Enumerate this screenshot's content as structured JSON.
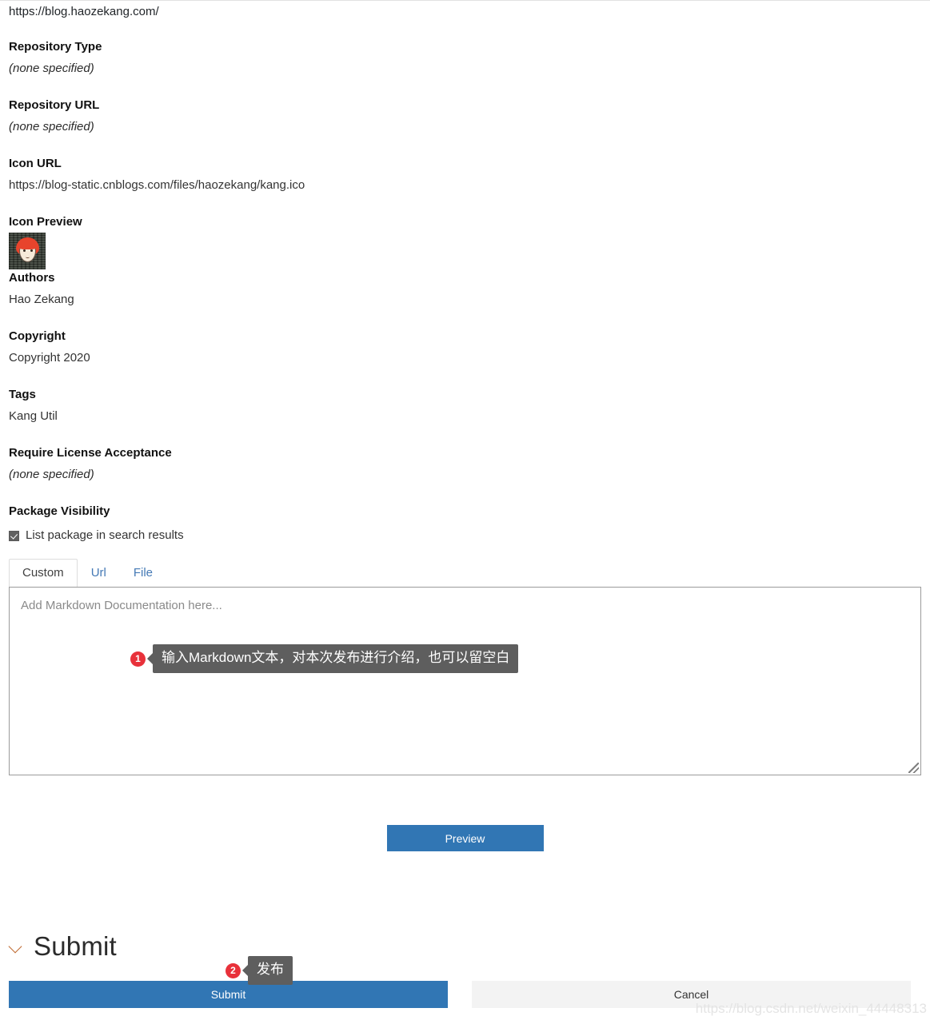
{
  "site_url": "https://blog.haozekang.com/",
  "metadata_fields": [
    {
      "label": "Repository Type",
      "value": "(none specified)",
      "italic": true
    },
    {
      "label": "Repository URL",
      "value": "(none specified)",
      "italic": true
    },
    {
      "label": "Icon URL",
      "value": "https://blog-static.cnblogs.com/files/haozekang/kang.ico",
      "italic": false
    }
  ],
  "icon_preview": {
    "label": "Icon Preview",
    "icon_name": "avatar-icon"
  },
  "authors": {
    "label": "Authors",
    "value": "Hao Zekang"
  },
  "copyright": {
    "label": "Copyright",
    "value": "Copyright 2020"
  },
  "tags": {
    "label": "Tags",
    "value": "Kang Util"
  },
  "require_license": {
    "label": "Require License Acceptance",
    "value": "(none specified)"
  },
  "package_visibility": {
    "label": "Package Visibility",
    "checkbox_label": "List package in search results",
    "checked": true
  },
  "doc_tabs": [
    {
      "label": "Custom",
      "active": true
    },
    {
      "label": "Url",
      "active": false
    },
    {
      "label": "File",
      "active": false
    }
  ],
  "markdown_editor": {
    "placeholder": "Add Markdown Documentation here...",
    "value": "",
    "resize_handle": "resize-grip-icon"
  },
  "callouts": [
    {
      "number": "1",
      "text": "输入Markdown文本，对本次发布进行介绍，也可以留空白"
    },
    {
      "number": "2",
      "text": "发布"
    }
  ],
  "preview_button": {
    "label": "Preview"
  },
  "submit_section": {
    "heading": "Submit",
    "chevron_icon": "chevron-down-icon",
    "submit_label": "Submit",
    "cancel_label": "Cancel"
  },
  "watermark": "https://blog.csdn.net/weixin_44448313",
  "colors": {
    "accent_blue": "#3176b4",
    "tab_link_blue": "#4479b5",
    "badge_red": "#e8313a",
    "tooltip_gray": "#5e5e5e",
    "cancel_gray": "#f3f3f3",
    "checkbox_gray": "#616161"
  }
}
